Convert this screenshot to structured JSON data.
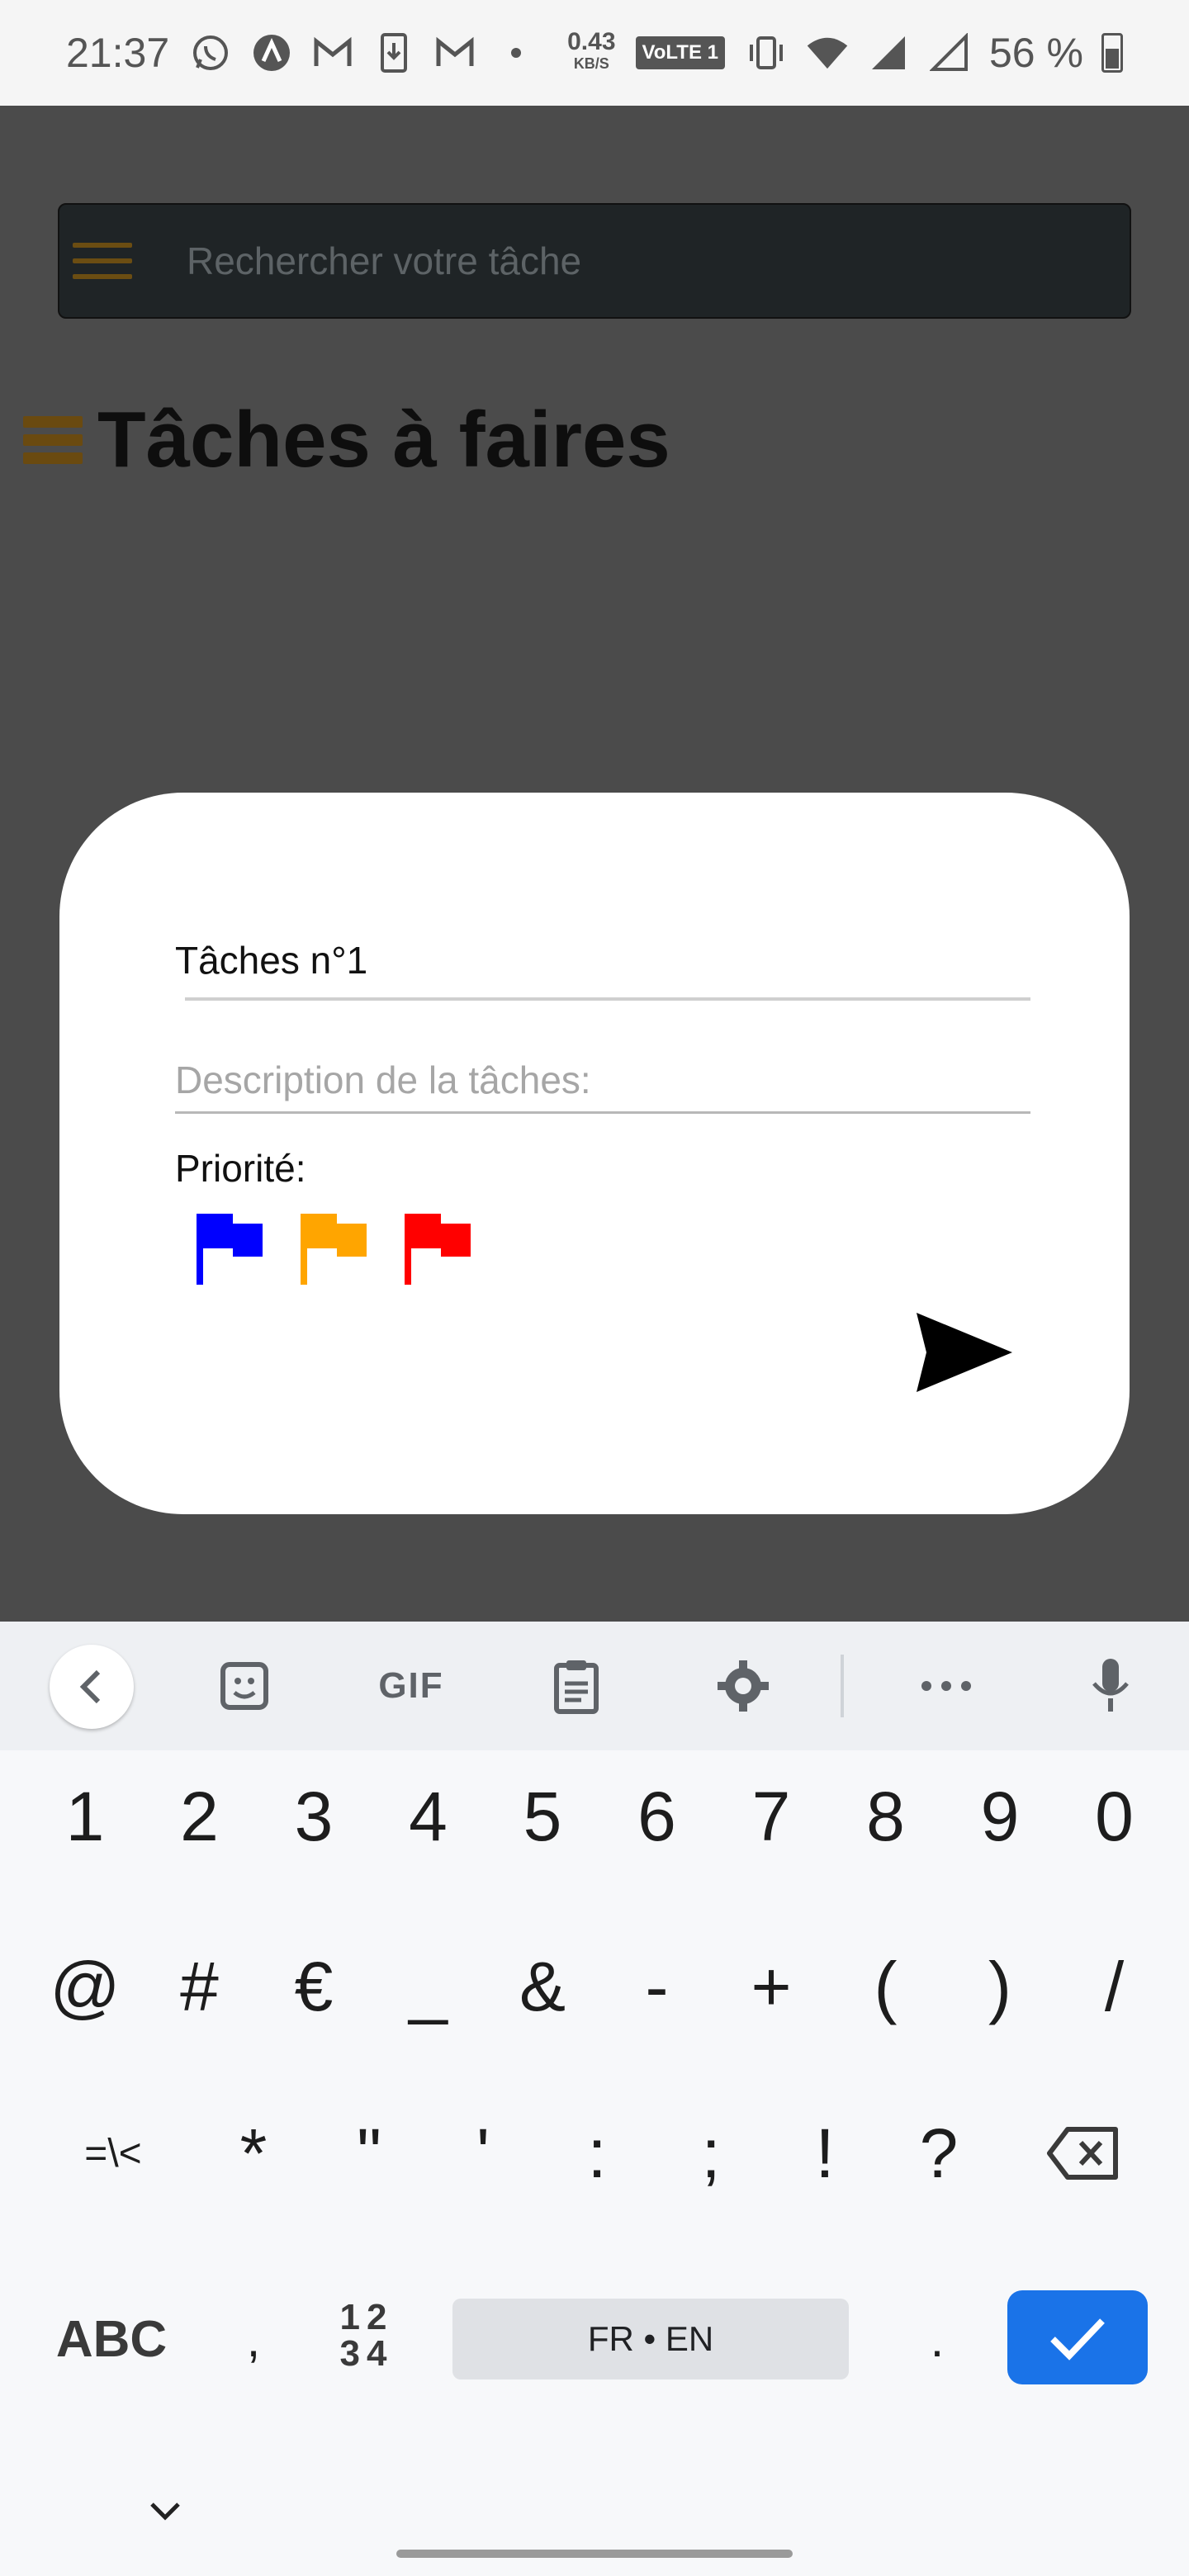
{
  "status_bar": {
    "time": "21:37",
    "speed_value": "0.43",
    "speed_unit": "KB/S",
    "volte": "VoLTE 1",
    "battery_text": "56 %"
  },
  "app": {
    "search": {
      "placeholder": "Rechercher votre tâche"
    },
    "page_title": "Tâches à faires",
    "accent_color": "#6b4d12"
  },
  "modal": {
    "title_value": "Tâches n°1",
    "description_placeholder": "Description de la tâches:",
    "priority_label": "Priorité:",
    "flags": [
      {
        "name": "low",
        "color": "#0000ff"
      },
      {
        "name": "medium",
        "color": "#ffa500"
      },
      {
        "name": "high",
        "color": "#ff0000"
      }
    ]
  },
  "keyboard": {
    "toolbar": {
      "gif_label": "GIF"
    },
    "row_numbers": [
      "1",
      "2",
      "3",
      "4",
      "5",
      "6",
      "7",
      "8",
      "9",
      "0"
    ],
    "row_symbols_1": [
      "@",
      "#",
      "€",
      "_",
      "&",
      "-",
      "+",
      "(",
      ")",
      "/"
    ],
    "row_symbols_2": [
      "=\\<",
      "*",
      "\"",
      "'",
      ":",
      ";",
      "!",
      "?"
    ],
    "abc_label": "ABC",
    "comma_label": ",",
    "numpad_top": "12",
    "numpad_bottom": "34",
    "space_label": "FR • EN",
    "period_label": ".",
    "enter_color": "#1a73e8"
  }
}
